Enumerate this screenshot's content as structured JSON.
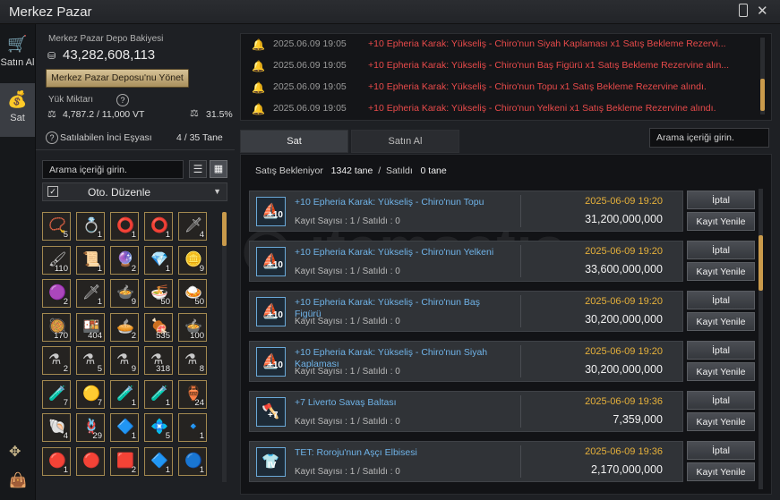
{
  "window": {
    "title": "Merkez Pazar"
  },
  "nav": {
    "buy_label": "Satın Al",
    "sell_label": "Sat"
  },
  "depot": {
    "balance_label": "Merkez Pazar Depo Bakiyesi",
    "balance_value": "43,282,608,113",
    "manage_button": "Merkez Pazar Deposu'nu Yönet",
    "weight_label": "Yük Miktarı",
    "weight_value": "4,787.2 / 11,000 VT",
    "weight_percent": "31.5%",
    "sellable_label": "Satılabilen İnci Eşyası",
    "sellable_value": "4 / 35 Tane"
  },
  "inventory": {
    "search_placeholder": "Arama içeriği girin.",
    "sort_label": "Oto. Düzenle",
    "items": [
      {
        "icon": "necklace-icon",
        "glyph": "📿",
        "count": "5"
      },
      {
        "icon": "ring-icon",
        "glyph": "💍",
        "count": "1"
      },
      {
        "icon": "ring-icon",
        "glyph": "⭕",
        "count": "1"
      },
      {
        "icon": "ring-icon",
        "glyph": "⭕",
        "count": "1"
      },
      {
        "icon": "staff-icon",
        "glyph": "🗡",
        "count": "4"
      },
      {
        "icon": "brush-icon",
        "glyph": "🖌",
        "count": "110"
      },
      {
        "icon": "scroll-icon",
        "glyph": "📜",
        "count": "1"
      },
      {
        "icon": "crystal-icon",
        "glyph": "🔮",
        "count": "2"
      },
      {
        "icon": "gem-icon",
        "glyph": "💎",
        "count": "1"
      },
      {
        "icon": "gold-icon",
        "glyph": "🪙",
        "count": "9"
      },
      {
        "icon": "purple-stone-icon",
        "glyph": "🟣",
        "count": "2"
      },
      {
        "icon": "sword-icon",
        "glyph": "🗡",
        "count": "1"
      },
      {
        "icon": "food-icon",
        "glyph": "🍲",
        "count": "9"
      },
      {
        "icon": "soup-icon",
        "glyph": "🍜",
        "count": "50"
      },
      {
        "icon": "meal-icon",
        "glyph": "🍛",
        "count": "50"
      },
      {
        "icon": "meal-icon",
        "glyph": "🥘",
        "count": "170"
      },
      {
        "icon": "meal-icon",
        "glyph": "🍱",
        "count": "404"
      },
      {
        "icon": "meal-icon",
        "glyph": "🥧",
        "count": "2"
      },
      {
        "icon": "meal-icon",
        "glyph": "🍖",
        "count": "535"
      },
      {
        "icon": "meal-icon",
        "glyph": "🍲",
        "count": "100"
      },
      {
        "icon": "potion-icon",
        "glyph": "⚗",
        "count": "2"
      },
      {
        "icon": "potion-icon",
        "glyph": "⚗",
        "count": "5"
      },
      {
        "icon": "potion-icon",
        "glyph": "⚗",
        "count": "9"
      },
      {
        "icon": "potion-icon",
        "glyph": "⚗",
        "count": "318"
      },
      {
        "icon": "potion-icon",
        "glyph": "⚗",
        "count": "8"
      },
      {
        "icon": "potion-icon",
        "glyph": "🧪",
        "count": "7"
      },
      {
        "icon": "ore-icon",
        "glyph": "🟡",
        "count": "7"
      },
      {
        "icon": "potion-icon",
        "glyph": "🧪",
        "count": "1"
      },
      {
        "icon": "potion-icon",
        "glyph": "🧪",
        "count": "1"
      },
      {
        "icon": "jar-icon",
        "glyph": "🏺",
        "count": "24"
      },
      {
        "icon": "shell-icon",
        "glyph": "🐚",
        "count": "4"
      },
      {
        "icon": "rope-icon",
        "glyph": "🪢",
        "count": "29"
      },
      {
        "icon": "crystal-icon",
        "glyph": "🔷",
        "count": "1"
      },
      {
        "icon": "crystal-icon",
        "glyph": "💠",
        "count": "5"
      },
      {
        "icon": "crystal-icon",
        "glyph": "🔹",
        "count": "1"
      },
      {
        "icon": "ruby-icon",
        "glyph": "🔴",
        "count": "1"
      },
      {
        "icon": "ruby-icon",
        "glyph": "🔴",
        "count": ""
      },
      {
        "icon": "ruby-icon",
        "glyph": "🟥",
        "count": "2"
      },
      {
        "icon": "sapphire-icon",
        "glyph": "🔷",
        "count": "1"
      },
      {
        "icon": "sapphire-icon",
        "glyph": "🔵",
        "count": "1"
      }
    ]
  },
  "notifications": [
    {
      "time": "2025.06.09 19:05",
      "message": "+10 Epheria Karak: Yükseliş - Chiro'nun Siyah Kaplaması x1 Satış Bekleme Rezervi..."
    },
    {
      "time": "2025.06.09 19:05",
      "message": "+10 Epheria Karak: Yükseliş - Chiro'nun Baş Figürü x1 Satış Bekleme Rezervine alın..."
    },
    {
      "time": "2025.06.09 19:05",
      "message": "+10 Epheria Karak: Yükseliş - Chiro'nun Topu x1 Satış Bekleme Rezervine alındı."
    },
    {
      "time": "2025.06.09 19:05",
      "message": "+10 Epheria Karak: Yükseliş - Chiro'nun Yelkeni x1 Satış Bekleme Rezervine alındı."
    }
  ],
  "tabs": {
    "sell": "Sat",
    "buy": "Satın Al"
  },
  "market_search": {
    "placeholder": "Arama içeriği girin."
  },
  "summary": {
    "waiting_label": "Satış Bekleniyor",
    "waiting_value": "1342 tane",
    "slash": "/",
    "sold_label": "Satıldı",
    "sold_value": "0 tane"
  },
  "listings": [
    {
      "name": "+10 Epheria Karak: Yükseliş - Chiro'nun Topu",
      "count": "Kayıt Sayısı : 1 / Satıldı : 0",
      "date": "2025-06-09 19:20",
      "price": "31,200,000,000",
      "badge": "+10",
      "glyph": "⛵"
    },
    {
      "name": "+10 Epheria Karak: Yükseliş - Chiro'nun Yelkeni",
      "count": "Kayıt Sayısı : 1 / Satıldı : 0",
      "date": "2025-06-09 19:20",
      "price": "33,600,000,000",
      "badge": "+10",
      "glyph": "⛵"
    },
    {
      "name": "+10 Epheria Karak: Yükseliş - Chiro'nun Baş Figürü",
      "count": "Kayıt Sayısı : 1 / Satıldı : 0",
      "date": "2025-06-09 19:20",
      "price": "30,200,000,000",
      "badge": "+10",
      "glyph": "⛵"
    },
    {
      "name": "+10 Epheria Karak: Yükseliş - Chiro'nun Siyah Kaplaması",
      "count": "Kayıt Sayısı : 1 / Satıldı : 0",
      "date": "2025-06-09 19:20",
      "price": "30,200,000,000",
      "badge": "+10",
      "glyph": "⛵"
    },
    {
      "name": "+7 Liverto Savaş Baltası",
      "count": "Kayıt Sayısı : 1 / Satıldı : 0",
      "date": "2025-06-09 19:36",
      "price": "7,359,000",
      "badge": "+7",
      "glyph": "🪓"
    },
    {
      "name": "TET: Roroju'nun Aşçı Elbisesi",
      "count": "Kayıt Sayısı : 1 / Satıldı : 0",
      "date": "2025-06-09 19:36",
      "price": "2,170,000,000",
      "badge": "IV",
      "glyph": "👕"
    }
  ],
  "actions": {
    "cancel": "İptal",
    "relist": "Kayıt Yenile"
  },
  "watermark": {
    "brand": "itemsatis",
    "tagline": "HESAP / SKIN / ITEM / E-PIN",
    "domain": ".com"
  }
}
